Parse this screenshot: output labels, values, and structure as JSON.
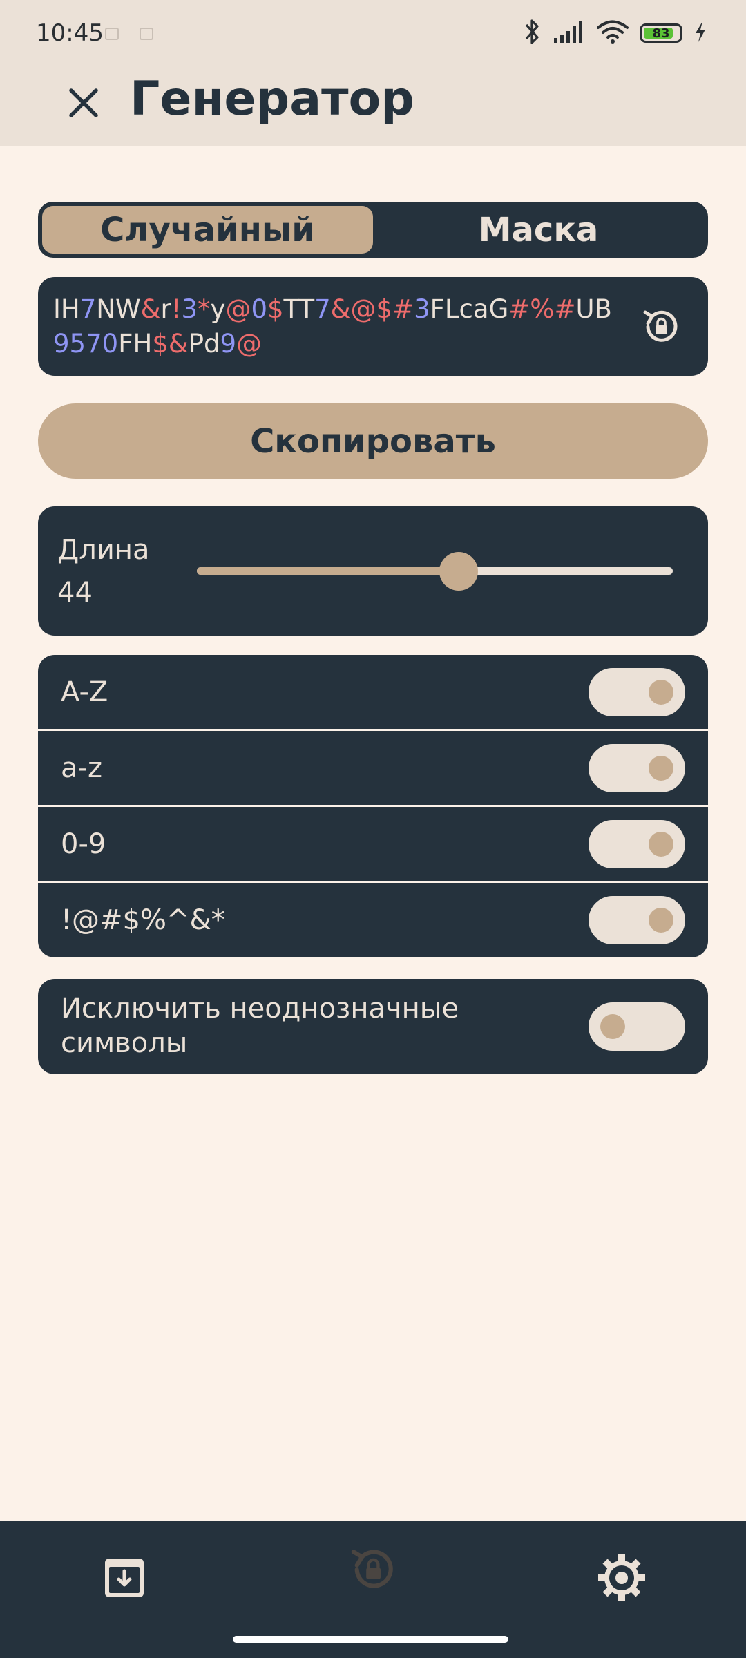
{
  "status_bar": {
    "time": "10:45",
    "battery_level": "83",
    "icons": [
      "bluetooth-icon",
      "signal-icon",
      "wifi-icon",
      "battery-icon",
      "charging-icon"
    ]
  },
  "header": {
    "title": "Генератор",
    "close_icon": "close-icon"
  },
  "mode_switch": {
    "tabs": [
      "Случайный",
      "Маска"
    ],
    "selected": "Случайный"
  },
  "password": {
    "value": "IH7NW&r!3*y@0$TT7&@$#3FLcaG#%#UB9570FH$&Pd9@",
    "regenerate_icon": "lock-reset-icon"
  },
  "copy_button": {
    "label": "Скопировать"
  },
  "length": {
    "label": "Длина",
    "value": "44",
    "slider_fraction": 0.55
  },
  "char_sets": [
    {
      "label": "A-Z",
      "enabled": true
    },
    {
      "label": "a-z",
      "enabled": true
    },
    {
      "label": "0-9",
      "enabled": true
    },
    {
      "label": "!@#$%^&*",
      "enabled": true
    }
  ],
  "exclude_ambiguous": {
    "label": "Исключить неоднозначные символы",
    "enabled": false
  },
  "bottom_nav": {
    "items": [
      "archive-download-icon",
      "lock-reset-icon",
      "gear-icon"
    ]
  },
  "colors": {
    "dark": "#25323d",
    "accent": "#c6ac8f",
    "light": "#ebe1d7",
    "background": "#fcf2e9",
    "digit": "#8f95f4",
    "symbol": "#ee6c6c"
  }
}
